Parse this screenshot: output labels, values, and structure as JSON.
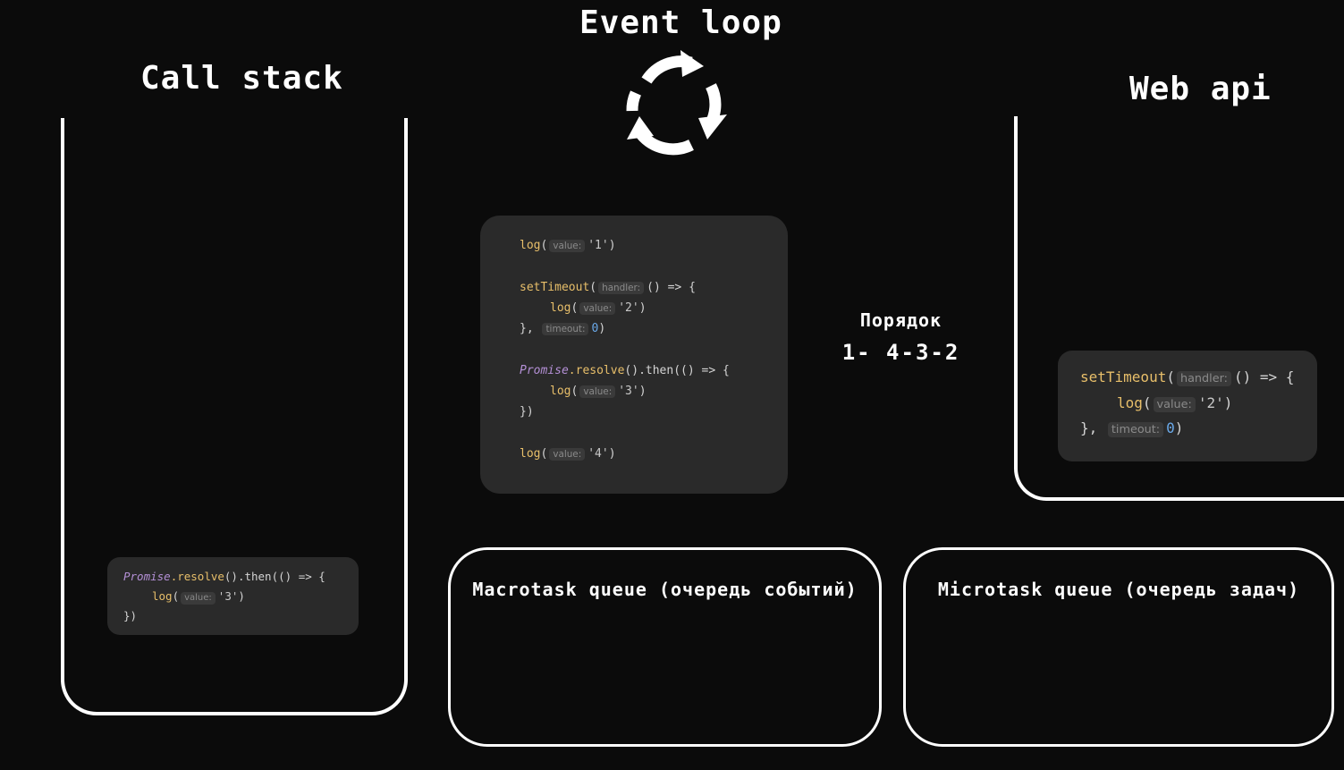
{
  "headings": {
    "event_loop": "Event loop",
    "call_stack": "Call stack",
    "web_api": "Web api"
  },
  "order": {
    "label": "Порядок",
    "sequence": "1- 4-3-2"
  },
  "queues": {
    "macrotask": "Macrotask queue (очередь событий)",
    "microtask": "Microtask queue (очередь задач)"
  },
  "code": {
    "log": "log",
    "setTimeout": "setTimeout",
    "promise": "Promise",
    "resolve": ".resolve",
    "then": ".then",
    "value_hint": "value:",
    "handler_hint": "handler:",
    "timeout_hint": "timeout:",
    "v1": "'1'",
    "v2": "'2'",
    "v3": "'3'",
    "v4": "'4'",
    "zero": "0",
    "open_paren": "(",
    "close_paren": ")",
    "arrow_open": "() => {",
    "call_then_open": "().then(() => {",
    "close_brace_comma": "},",
    "close_brace_paren": "})"
  },
  "icons": {
    "loop": "circular-arrows-icon"
  }
}
